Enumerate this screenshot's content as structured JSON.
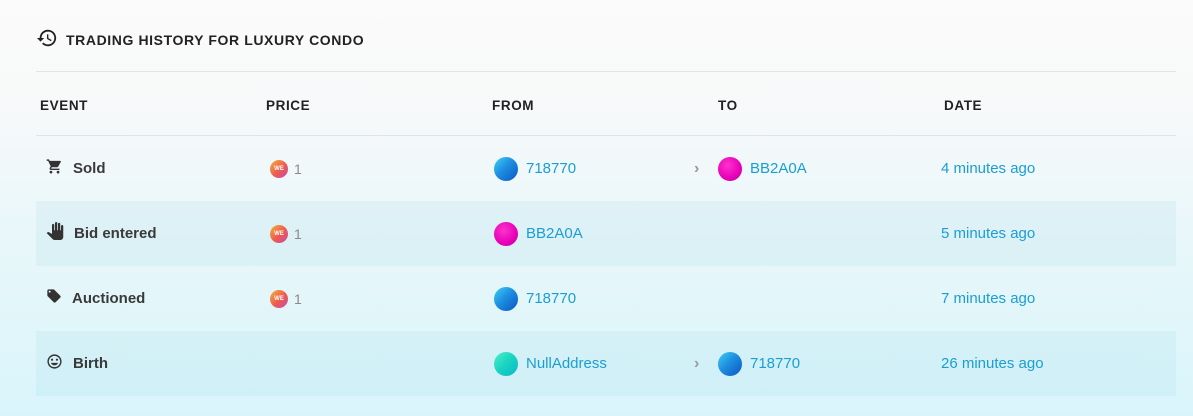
{
  "header": {
    "icon": "history-icon",
    "title": "TRADING HISTORY FOR LUXURY CONDO"
  },
  "columns": {
    "event": "EVENT",
    "price": "PRICE",
    "from": "FROM",
    "to": "TO",
    "date": "DATE"
  },
  "coin": {
    "label": "WE"
  },
  "rows": [
    {
      "event": "Sold",
      "event_icon": "cart-icon",
      "price": "1",
      "from": "718770",
      "to": "BB2A0A",
      "date": "4 minutes ago"
    },
    {
      "event": "Bid entered",
      "event_icon": "hand-icon",
      "price": "1",
      "from": "BB2A0A",
      "to": "",
      "date": "5 minutes ago"
    },
    {
      "event": "Auctioned",
      "event_icon": "tag-icon",
      "price": "1",
      "from": "718770",
      "to": "",
      "date": "7 minutes ago"
    },
    {
      "event": "Birth",
      "event_icon": "smiley-icon",
      "price": "",
      "from": "NullAddress",
      "to": "718770",
      "date": "26 minutes ago"
    }
  ],
  "colors": {
    "link": "#1a9ed4",
    "avatar_blue": "#1d8fe0",
    "avatar_pink": "#e600b8",
    "avatar_teal": "#17d3c0"
  }
}
